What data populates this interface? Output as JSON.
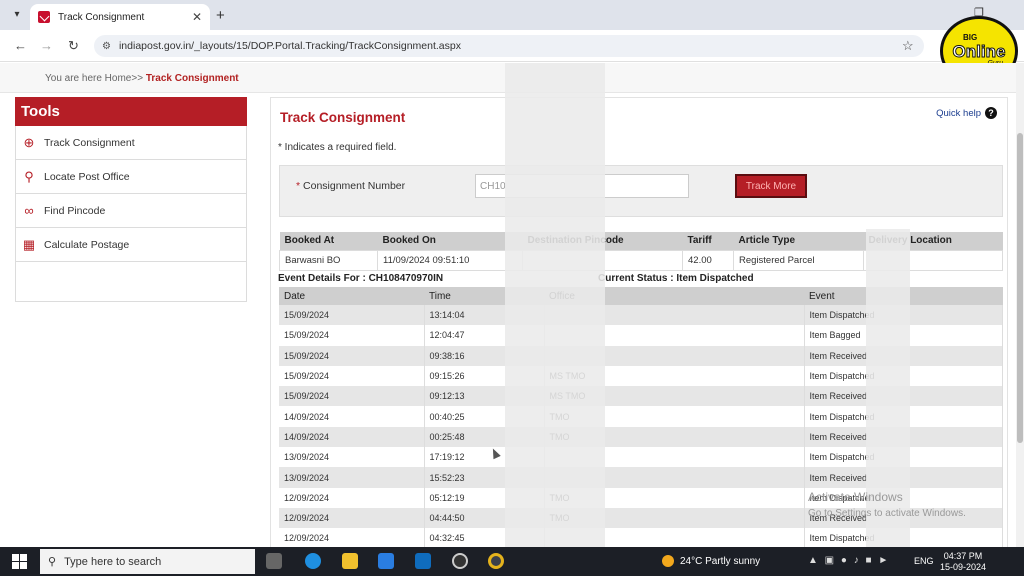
{
  "browser": {
    "tab_title": "Track Consignment",
    "url": "indiapost.gov.in/_layouts/15/DOP.Portal.Tracking/TrackConsignment.aspx"
  },
  "breadcrumb": {
    "prefix": "You are here Home>>",
    "current": "Track Consignment"
  },
  "sidebar": {
    "title": "Tools",
    "items": [
      {
        "label": "Track Consignment",
        "icon": "crosshair-icon"
      },
      {
        "label": "Locate Post Office",
        "icon": "map-pin-icon"
      },
      {
        "label": "Find Pincode",
        "icon": "binoculars-icon"
      },
      {
        "label": "Calculate Postage",
        "icon": "calculator-icon"
      }
    ]
  },
  "main": {
    "title": "Track Consignment",
    "quick_help": "Quick help",
    "required_note": "* Indicates a required field.",
    "form": {
      "label_star": "*",
      "label": "Consignment Number",
      "input_value": "CH10",
      "button": "Track More"
    },
    "summary": {
      "headers": [
        "Booked At",
        "Booked On",
        "Destination Pincode",
        "Tariff",
        "Article Type",
        "Delivery Location"
      ],
      "row": [
        "Barwasni BO",
        "11/09/2024 09:51:10",
        "",
        "42.00",
        "Registered Parcel",
        ""
      ]
    },
    "event_title": "Event Details For : CH108470970IN",
    "current_status": "Current Status : Item Dispatched",
    "events": {
      "headers": [
        "Date",
        "Time",
        "Office",
        "Event"
      ],
      "rows": [
        [
          "15/09/2024",
          "13:14:04",
          "",
          "Item Dispatched"
        ],
        [
          "15/09/2024",
          "12:04:47",
          "",
          "Item Bagged"
        ],
        [
          "15/09/2024",
          "09:38:16",
          "",
          "Item Received"
        ],
        [
          "15/09/2024",
          "09:15:26",
          "MS TMO",
          "Item Dispatched"
        ],
        [
          "15/09/2024",
          "09:12:13",
          "MS TMO",
          "Item Received"
        ],
        [
          "14/09/2024",
          "00:40:25",
          "TMO",
          "Item Dispatched"
        ],
        [
          "14/09/2024",
          "00:25:48",
          "TMO",
          "Item Received"
        ],
        [
          "13/09/2024",
          "17:19:12",
          "",
          "Item Dispatched"
        ],
        [
          "13/09/2024",
          "15:52:23",
          "",
          "Item Received"
        ],
        [
          "12/09/2024",
          "05:12:19",
          "TMO",
          "Item Dispatched"
        ],
        [
          "12/09/2024",
          "04:44:50",
          "TMO",
          "Item Received"
        ],
        [
          "12/09/2024",
          "04:32:45",
          "",
          "Item Dispatched"
        ]
      ]
    }
  },
  "watermark": {
    "title": "Activate Windows",
    "subtitle": "Go to Settings to activate Windows."
  },
  "logo": {
    "top": "BIG",
    "main": "Online",
    "bottom": "Guru"
  },
  "taskbar": {
    "search_placeholder": "Type here to search",
    "weather": "24°C  Partly sunny",
    "lang": "ENG",
    "time": "04:37 PM",
    "date": "15-09-2024"
  },
  "colors": {
    "brand_red": "#b51e26",
    "header_gray": "#cfcfcf"
  }
}
